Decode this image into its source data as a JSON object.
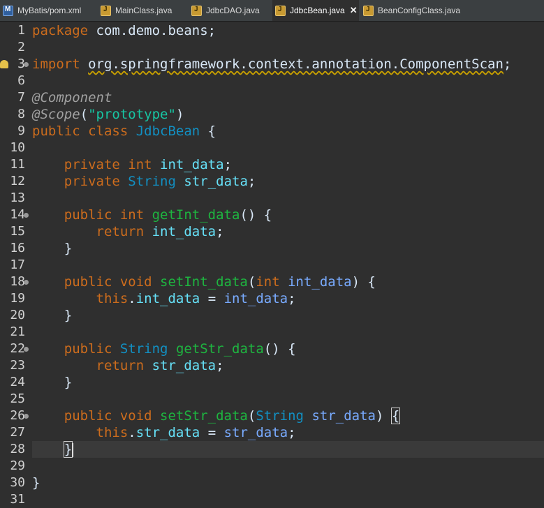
{
  "tabs": [
    {
      "label": "MyBatis/pom.xml",
      "icon": "maven-file-icon"
    },
    {
      "label": "MainClass.java",
      "icon": "java-file-icon"
    },
    {
      "label": "JdbcDAO.java",
      "icon": "java-file-icon"
    },
    {
      "label": "JdbcBean.java",
      "icon": "java-file-icon",
      "active": true,
      "close": "✕"
    },
    {
      "label": "BeanConfigClass.java",
      "icon": "java-file-icon"
    }
  ],
  "lines": [
    {
      "n": "1",
      "tokens": [
        [
          "k",
          "package"
        ],
        [
          "n",
          " com.demo.beans;"
        ]
      ]
    },
    {
      "n": "2",
      "tokens": []
    },
    {
      "n": "3",
      "tokens": [
        [
          "k",
          "import"
        ],
        [
          "n",
          " "
        ],
        [
          "sq",
          "org.springframework.context.annotation.ComponentScan"
        ],
        [
          "n",
          ";"
        ]
      ],
      "warn": true,
      "fold": true
    },
    {
      "n": "6",
      "tokens": []
    },
    {
      "n": "7",
      "tokens": [
        [
          "a",
          "@Component"
        ]
      ]
    },
    {
      "n": "8",
      "tokens": [
        [
          "a",
          "@Scope"
        ],
        [
          "n",
          "("
        ],
        [
          "s",
          "\"prototype\""
        ],
        [
          "n",
          ")"
        ]
      ]
    },
    {
      "n": "9",
      "tokens": [
        [
          "k",
          "public class "
        ],
        [
          "t",
          "JdbcBean"
        ],
        [
          "n",
          " {"
        ]
      ]
    },
    {
      "n": "10",
      "tokens": []
    },
    {
      "n": "11",
      "tokens": [
        [
          "n",
          "    "
        ],
        [
          "k",
          "private int "
        ],
        [
          "v",
          "int_data"
        ],
        [
          "n",
          ";"
        ]
      ]
    },
    {
      "n": "12",
      "tokens": [
        [
          "n",
          "    "
        ],
        [
          "k",
          "private "
        ],
        [
          "t",
          "String"
        ],
        [
          "n",
          " "
        ],
        [
          "v",
          "str_data"
        ],
        [
          "n",
          ";"
        ]
      ]
    },
    {
      "n": "13",
      "tokens": []
    },
    {
      "n": "14",
      "tokens": [
        [
          "n",
          "    "
        ],
        [
          "k",
          "public int "
        ],
        [
          "m",
          "getInt_data"
        ],
        [
          "n",
          "() {"
        ]
      ],
      "fold": true
    },
    {
      "n": "15",
      "tokens": [
        [
          "n",
          "        "
        ],
        [
          "k",
          "return "
        ],
        [
          "v",
          "int_data"
        ],
        [
          "n",
          ";"
        ]
      ]
    },
    {
      "n": "16",
      "tokens": [
        [
          "n",
          "    }"
        ]
      ]
    },
    {
      "n": "17",
      "tokens": []
    },
    {
      "n": "18",
      "tokens": [
        [
          "n",
          "    "
        ],
        [
          "k",
          "public void "
        ],
        [
          "m",
          "setInt_data"
        ],
        [
          "n",
          "("
        ],
        [
          "k",
          "int "
        ],
        [
          "p",
          "int_data"
        ],
        [
          "n",
          ") {"
        ]
      ],
      "fold": true
    },
    {
      "n": "19",
      "tokens": [
        [
          "n",
          "        "
        ],
        [
          "k",
          "this"
        ],
        [
          "n",
          "."
        ],
        [
          "v",
          "int_data"
        ],
        [
          "n",
          " = "
        ],
        [
          "p",
          "int_data"
        ],
        [
          "n",
          ";"
        ]
      ]
    },
    {
      "n": "20",
      "tokens": [
        [
          "n",
          "    }"
        ]
      ]
    },
    {
      "n": "21",
      "tokens": []
    },
    {
      "n": "22",
      "tokens": [
        [
          "n",
          "    "
        ],
        [
          "k",
          "public "
        ],
        [
          "t",
          "String"
        ],
        [
          "n",
          " "
        ],
        [
          "m",
          "getStr_data"
        ],
        [
          "n",
          "() {"
        ]
      ],
      "fold": true
    },
    {
      "n": "23",
      "tokens": [
        [
          "n",
          "        "
        ],
        [
          "k",
          "return "
        ],
        [
          "v",
          "str_data"
        ],
        [
          "n",
          ";"
        ]
      ]
    },
    {
      "n": "24",
      "tokens": [
        [
          "n",
          "    }"
        ]
      ]
    },
    {
      "n": "25",
      "tokens": []
    },
    {
      "n": "26",
      "tokens": [
        [
          "n",
          "    "
        ],
        [
          "k",
          "public void "
        ],
        [
          "m",
          "setStr_data"
        ],
        [
          "n",
          "("
        ],
        [
          "t",
          "String"
        ],
        [
          "n",
          " "
        ],
        [
          "p",
          "str_data"
        ],
        [
          "n",
          ") "
        ],
        [
          "b",
          "{"
        ]
      ],
      "fold": true
    },
    {
      "n": "27",
      "tokens": [
        [
          "n",
          "        "
        ],
        [
          "k",
          "this"
        ],
        [
          "n",
          "."
        ],
        [
          "v",
          "str_data"
        ],
        [
          "n",
          " = "
        ],
        [
          "p",
          "str_data"
        ],
        [
          "n",
          ";"
        ]
      ]
    },
    {
      "n": "28",
      "tokens": [
        [
          "n",
          "    "
        ],
        [
          "b",
          "}"
        ],
        [
          "caret",
          ""
        ]
      ],
      "current": true
    },
    {
      "n": "29",
      "tokens": []
    },
    {
      "n": "30",
      "tokens": [
        [
          "n",
          "}"
        ]
      ]
    },
    {
      "n": "31",
      "tokens": []
    }
  ]
}
